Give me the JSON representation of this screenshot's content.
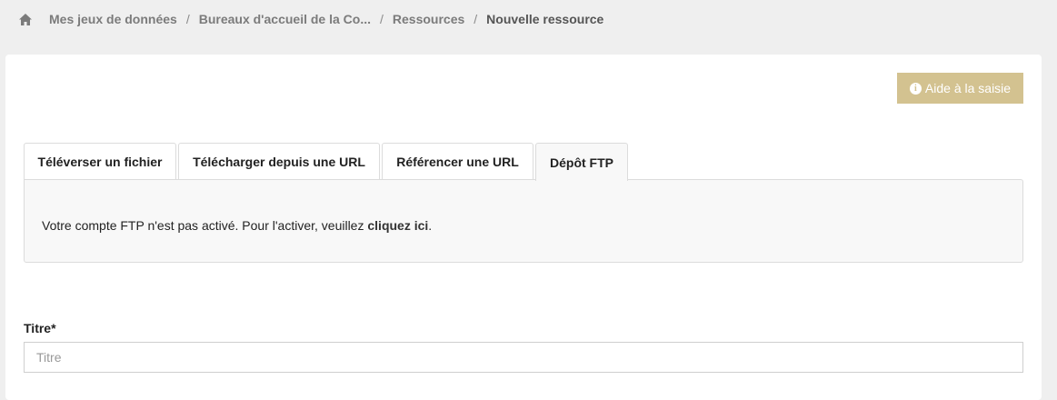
{
  "breadcrumb": {
    "items": [
      "Mes jeux de données",
      "Bureaux d'accueil de la Co...",
      "Ressources"
    ],
    "current": "Nouvelle ressource",
    "separator": "/"
  },
  "help_button": {
    "label": "Aide à la saisie",
    "icon": "info-circle-icon"
  },
  "tabs": [
    {
      "label": "Téléverser un fichier"
    },
    {
      "label": "Télécharger depuis une URL"
    },
    {
      "label": "Référencer une URL"
    },
    {
      "label": "Dépôt FTP",
      "active": true
    }
  ],
  "ftp_panel": {
    "message": "Votre compte FTP n'est pas activé. Pour l'activer, veuillez ",
    "link_label": "cliquez ici",
    "suffix": "."
  },
  "form": {
    "title_label": "Titre*",
    "title_placeholder": "Titre",
    "title_value": ""
  },
  "colors": {
    "accent": "#d3c290",
    "page_bg": "#efefef"
  }
}
